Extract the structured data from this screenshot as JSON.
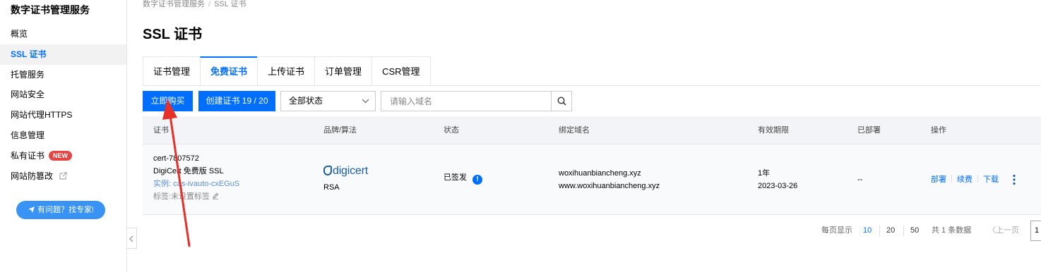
{
  "sidebar": {
    "title": "数字证书管理服务",
    "items": [
      {
        "label": "概览"
      },
      {
        "label": "SSL 证书"
      },
      {
        "label": "托管服务"
      },
      {
        "label": "网站安全"
      },
      {
        "label": "网站代理HTTPS"
      },
      {
        "label": "信息管理"
      },
      {
        "label": "私有证书",
        "badge": "NEW"
      },
      {
        "label": "网站防篡改"
      }
    ],
    "help_button": "有问题？找专家!"
  },
  "breadcrumb": {
    "parent": "数字证书管理服务",
    "separator": "/",
    "current": "SSL 证书"
  },
  "page_title": "SSL 证书",
  "tabs": [
    {
      "label": "证书管理"
    },
    {
      "label": "免费证书"
    },
    {
      "label": "上传证书"
    },
    {
      "label": "订单管理"
    },
    {
      "label": "CSR管理"
    }
  ],
  "toolbar": {
    "buy_now": "立即购买",
    "create_cert": "创建证书 19 / 20",
    "status_filter": "全部状态",
    "search_placeholder": "请输入域名"
  },
  "table": {
    "headers": [
      "证书",
      "品牌/算法",
      "状态",
      "绑定域名",
      "有效期限",
      "已部署",
      "操作"
    ],
    "rows": [
      {
        "cert_id": "cert-7807572",
        "cert_name": "DigiCert 免费版 SSL",
        "instance": "实例: cas-ivauto-cxEGuS",
        "tag": "标签:未设置标签",
        "brand_logo": "digicert",
        "algorithm": "RSA",
        "status": "已签发",
        "domains": [
          "woxihuanbiancheng.xyz",
          "www.woxihuanbiancheng.xyz"
        ],
        "validity": "1年",
        "expiry": "2023-03-26",
        "deployed": "--",
        "actions": [
          "部署",
          "续费",
          "下载"
        ]
      }
    ]
  },
  "pagination": {
    "per_page_label": "每页显示",
    "sizes": [
      "10",
      "20",
      "50"
    ],
    "total": "共 1 条数据",
    "prev": "〈上一页",
    "current_page": "1"
  },
  "colors": {
    "primary": "#006eff",
    "badge": "#e54545",
    "annotation": "#e8302a"
  }
}
